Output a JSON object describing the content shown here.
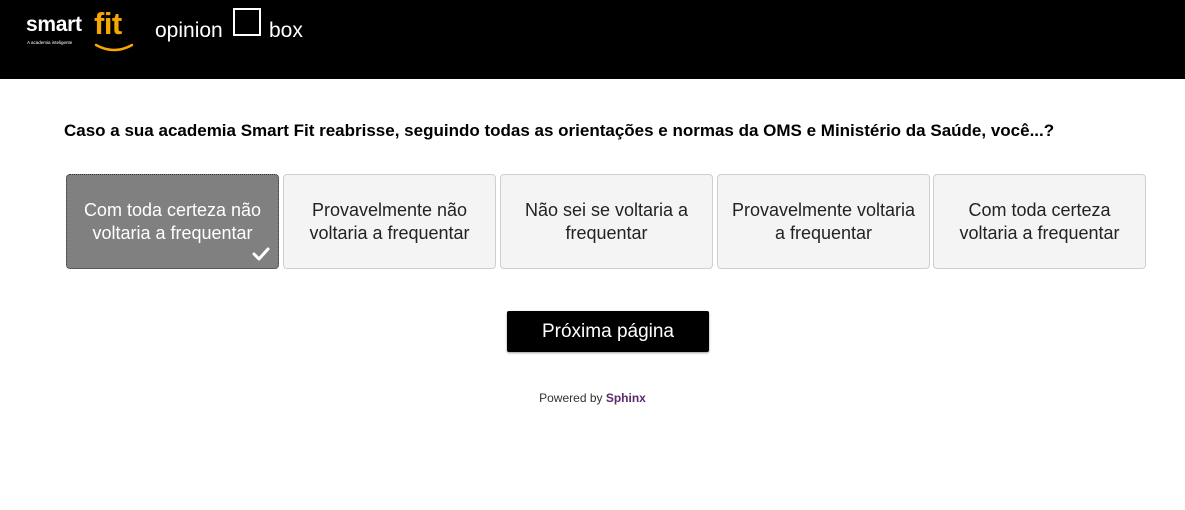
{
  "header": {
    "smartfit_logo": {
      "word1": "smart",
      "word2": "fit",
      "tagline": "A academia inteligente",
      "accent": "#f6a600"
    },
    "opinionbox_logo": {
      "word1": "opinion",
      "word2": "box"
    }
  },
  "survey": {
    "question": "Caso a sua academia Smart Fit reabrisse, seguindo todas as orientações e normas da OMS e Ministério da Saúde, você...?",
    "options": [
      {
        "label": "Com toda certeza não voltaria a frequentar",
        "selected": true
      },
      {
        "label": "Provavelmente não voltaria a frequentar",
        "selected": false
      },
      {
        "label": "Não sei se voltaria a frequentar",
        "selected": false
      },
      {
        "label": "Provavelmente voltaria a frequentar",
        "selected": false
      },
      {
        "label": "Com toda certeza voltaria a frequentar",
        "selected": false
      }
    ],
    "selected_icon": "checkmark-icon",
    "next_button": "Próxima página"
  },
  "footer": {
    "powered_by": "Powered by",
    "brand": "Sphinx",
    "brand_color": "#5b2a6e"
  }
}
